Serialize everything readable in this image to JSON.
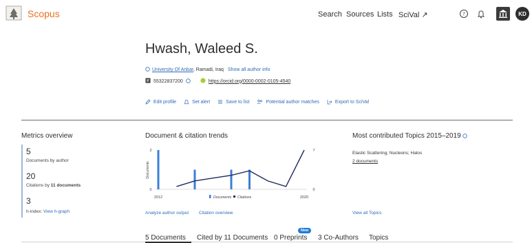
{
  "header": {
    "brand": "Scopus",
    "nav": [
      "Search",
      "Sources",
      "Lists",
      "SciVal ↗"
    ],
    "avatar_initials": "KD"
  },
  "author": {
    "name": "Hwash, Waleed S.",
    "affiliation_link": "University Of Anbar",
    "affiliation_rest": ", Ramadi, Iraq",
    "show_all": "Show all author info",
    "scopus_id": "55322837200",
    "orcid": "https://orcid.org/0000-0002-0105-4540"
  },
  "actions": [
    "Edit profile",
    "Set alert",
    "Save to list",
    "Potential author matches",
    "Export to SciVal"
  ],
  "metrics": {
    "title": "Metrics overview",
    "documents_value": "5",
    "documents_label": "Documents by author",
    "citations_value": "20",
    "citations_label_prefix": "Citations by ",
    "citations_label_bold": "11 documents",
    "hindex_value": "3",
    "hindex_label": "h-index:",
    "hindex_link": "View h-graph"
  },
  "trends": {
    "title": "Document & citation trends",
    "analyze_link": "Analyze author output",
    "citation_link": "Citation overview"
  },
  "topics": {
    "title": "Most contributed Topics 2015–2019",
    "topic": "Elastic Scattering; Nucleons; Halos",
    "docs_link": "2 documents",
    "view_all": "View all Topics"
  },
  "tabs": {
    "documents": "5 Documents",
    "cited_by": "Cited by 11 Documents",
    "preprints": "0 Preprints",
    "new_badge": "New",
    "coauthors": "3 Co-Authors",
    "topics": "Topics"
  },
  "chart_data": {
    "type": "bar",
    "title": "Document & citation trends",
    "xlabel": "",
    "ylabel": "Documents",
    "y2label": "Citations",
    "x_tick_labels": [
      "2012",
      "2020"
    ],
    "y_ticks": [
      "0",
      "1",
      "2"
    ],
    "y2_ticks": [
      "0",
      "7"
    ],
    "ylim": [
      0,
      2
    ],
    "y2lim": [
      0,
      7
    ],
    "years": [
      2012,
      2013,
      2014,
      2015,
      2016,
      2017,
      2018,
      2019,
      2020
    ],
    "series": [
      {
        "name": "Documents",
        "kind": "bar",
        "values": [
          2,
          0,
          1,
          0,
          1,
          1,
          0,
          0,
          0
        ],
        "color": "#3a7fd6"
      },
      {
        "name": "Citations",
        "kind": "line",
        "values": [
          null,
          0.5,
          1.5,
          2,
          2.5,
          3.3,
          1.5,
          0.5,
          7
        ],
        "color": "#1f2a5c"
      }
    ],
    "legend_position": "bottom"
  }
}
